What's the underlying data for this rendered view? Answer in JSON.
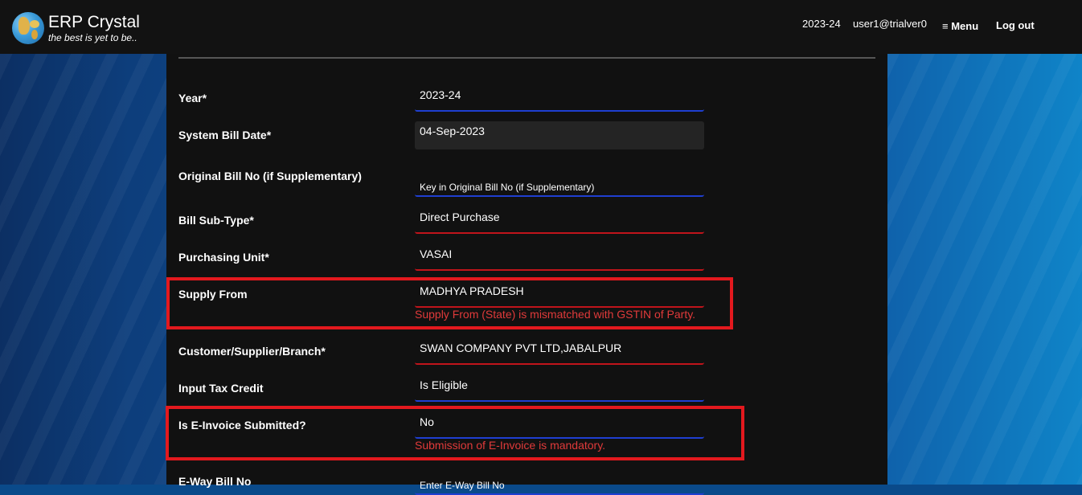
{
  "header": {
    "app_title": "ERP Crystal",
    "tagline": "the best is yet to be..",
    "year": "2023-24",
    "user": "user1@trialver0",
    "menu_label": "≡ Menu",
    "logout_label": "Log out"
  },
  "form": {
    "year": {
      "label": "Year*",
      "value": "2023-24"
    },
    "system_bill_date": {
      "label": "System Bill Date*",
      "value": "04-Sep-2023"
    },
    "original_bill_no": {
      "label": "Original Bill No (if Supplementary)",
      "placeholder": "Key in Original Bill No (if Supplementary)"
    },
    "bill_sub_type": {
      "label": "Bill Sub-Type*",
      "value": "Direct Purchase"
    },
    "purchasing_unit": {
      "label": "Purchasing Unit*",
      "value": "VASAI"
    },
    "supply_from": {
      "label": "Supply From",
      "value": "MADHYA PRADESH",
      "error": "Supply From (State) is mismatched with GSTIN of Party."
    },
    "customer_supplier_branch": {
      "label": "Customer/Supplier/Branch*",
      "value": "SWAN COMPANY PVT LTD,JABALPUR"
    },
    "input_tax_credit": {
      "label": "Input Tax Credit",
      "value": "Is Eligible"
    },
    "e_invoice_submitted": {
      "label": "Is E-Invoice Submitted?",
      "value": "No",
      "error": "Submission of E-Invoice is mandatory."
    },
    "eway_bill_no": {
      "label": "E-Way Bill No",
      "placeholder": "Enter E-Way Bill No"
    }
  },
  "colors": {
    "header_bg": "#121212",
    "panel_bg": "#111111",
    "valid_underline": "#1f3fd1",
    "invalid_underline": "#c0141b",
    "error_text": "#e03a3a",
    "highlight_box": "#e3191e"
  }
}
